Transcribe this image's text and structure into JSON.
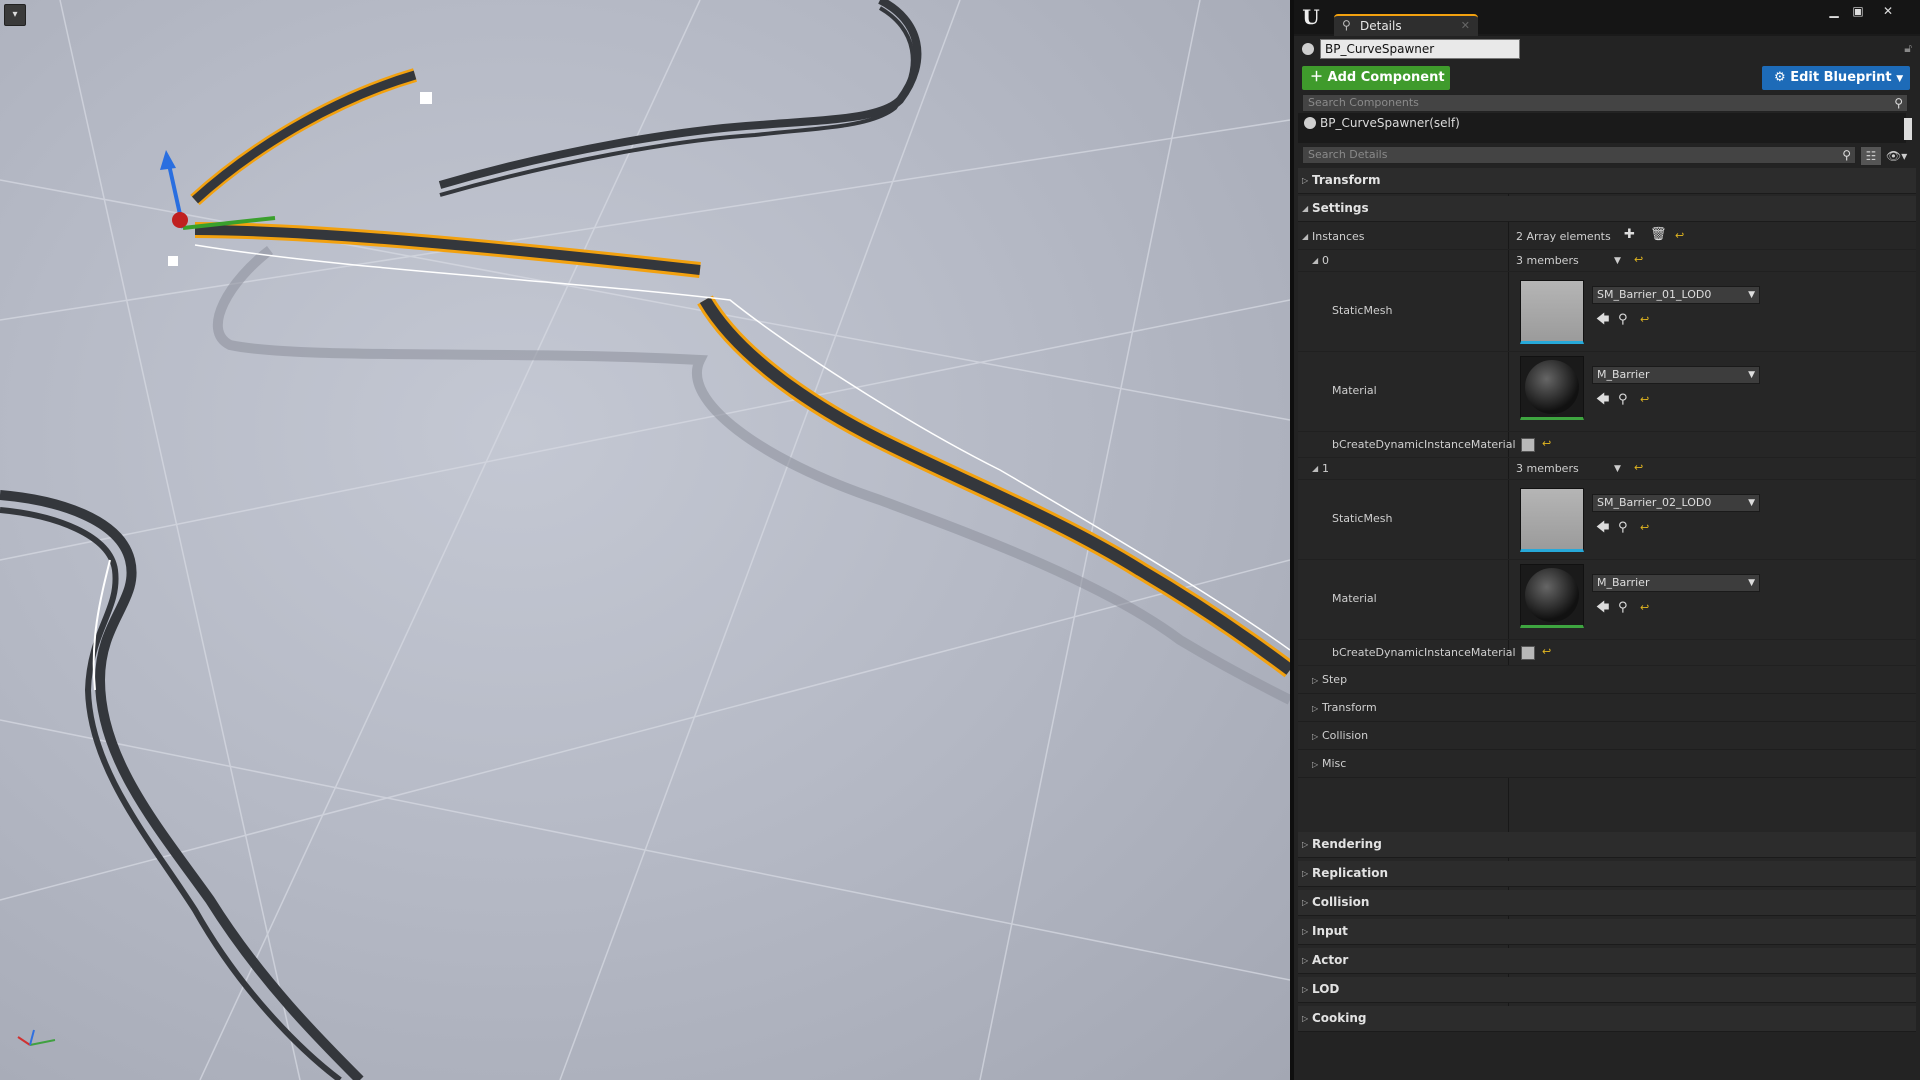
{
  "viewport": {
    "menu_glyph": "▾",
    "colors": {
      "fence": "#34373c",
      "selection_outline": "#f2a10f",
      "ground": "#b9bdc9"
    }
  },
  "window": {
    "logo": "U",
    "tab_label": "Details",
    "tab_icon": "magnifier-icon",
    "controls": [
      "minimize-icon",
      "maximize-icon",
      "close-icon"
    ]
  },
  "details": {
    "actor_name": "BP_CurveSpawner",
    "add_component_label": "Add Component",
    "edit_blueprint_label": "Edit Blueprint",
    "search_components_placeholder": "Search Components",
    "components": [
      "BP_CurveSpawner(self)"
    ],
    "search_details_placeholder": "Search Details",
    "categories_top": [
      "Transform",
      "Settings"
    ],
    "instances": {
      "label": "Instances",
      "count_text": "2 Array elements",
      "elements": [
        {
          "index": "0",
          "members": "3 members",
          "static_mesh_label": "StaticMesh",
          "static_mesh": "SM_Barrier_01_LOD0",
          "material_label": "Material",
          "material": "M_Barrier",
          "bool_label": "bCreateDynamicInstanceMaterial"
        },
        {
          "index": "1",
          "members": "3 members",
          "static_mesh_label": "StaticMesh",
          "static_mesh": "SM_Barrier_02_LOD0",
          "material_label": "Material",
          "material": "M_Barrier",
          "bool_label": "bCreateDynamicInstanceMaterial"
        }
      ]
    },
    "sub_categories": [
      "Step",
      "Transform",
      "Collision",
      "Misc"
    ],
    "categories_bottom": [
      "Rendering",
      "Replication",
      "Collision",
      "Input",
      "Actor",
      "LOD",
      "Cooking"
    ],
    "colors": {
      "add_button": "#3f9b2c",
      "edit_button": "#1d6bb8",
      "tab_accent": "#f2a10f",
      "mesh_thumb_accent": "#27a9d9",
      "material_thumb_accent": "#3ea540",
      "reset_arrow": "#e0b520"
    }
  }
}
